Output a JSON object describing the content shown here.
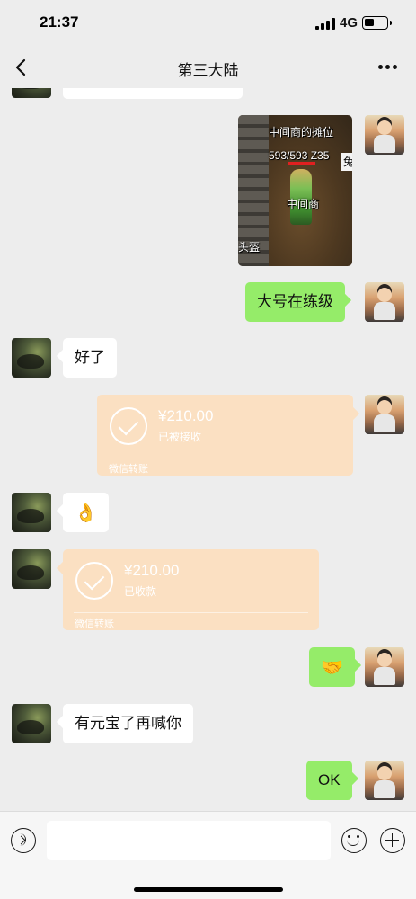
{
  "status_bar": {
    "time": "21:37",
    "network": "4G"
  },
  "nav": {
    "title": "第三大陆"
  },
  "game_image": {
    "stall_label": "中间商的摊位",
    "stats": "593/593 Z35",
    "name": "中间商",
    "side_text": "兔",
    "helmet_text": "头盔"
  },
  "messages": {
    "self_text_1": "大号在练级",
    "other_text_1": "好了",
    "transfer_1": {
      "amount": "¥210.00",
      "status": "已被接收",
      "source": "微信转账"
    },
    "other_emoji": "👌",
    "transfer_2": {
      "amount": "¥210.00",
      "status": "已收款",
      "source": "微信转账"
    },
    "self_emoji": "🤝",
    "other_text_2": "有元宝了再喊你",
    "self_text_2": "OK"
  },
  "input": {
    "value": "",
    "placeholder": ""
  },
  "icons": {
    "back": "back-icon",
    "more": "more-icon",
    "voice": "voice-icon",
    "emoji": "emoji-icon",
    "plus": "plus-icon",
    "transfer": "check-circle-icon"
  },
  "colors": {
    "background": "#ededed",
    "self_bubble": "#95ec69",
    "other_bubble": "#ffffff",
    "transfer_card": "#fbe0c2"
  }
}
